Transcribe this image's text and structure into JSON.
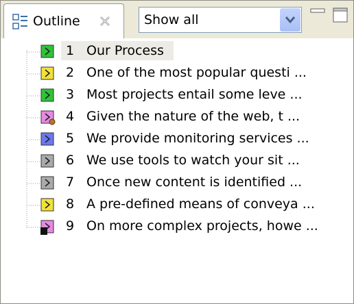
{
  "tab": {
    "label": "Outline",
    "icon": "outline-icon"
  },
  "filter": {
    "selected": "Show all"
  },
  "window_controls": {
    "minimize": "minimize-icon",
    "maximize": "maximize-icon",
    "close": "close-icon"
  },
  "colors": {
    "green": "#2fc23a",
    "yellow": "#f1e23a",
    "pink": "#e58ae0",
    "blue": "#6c78f0",
    "gray": "#aaaaaa"
  },
  "items": [
    {
      "num": "1",
      "text": "Our Process",
      "color": "green",
      "selected": true
    },
    {
      "num": "2",
      "text": "One of the most popular questi ...",
      "color": "yellow"
    },
    {
      "num": "3",
      "text": "Most projects entail some leve ...",
      "color": "green"
    },
    {
      "num": "4",
      "text": "Given the nature of the web, t ...",
      "color": "pink",
      "overlay": "gear"
    },
    {
      "num": "5",
      "text": "We provide monitoring services ...",
      "color": "blue"
    },
    {
      "num": "6",
      "text": "We use tools to watch your sit ...",
      "color": "gray"
    },
    {
      "num": "7",
      "text": "Once new content is identified ...",
      "color": "gray"
    },
    {
      "num": "8",
      "text": "A pre-defined means of conveya ...",
      "color": "yellow"
    },
    {
      "num": "9",
      "text": "On more complex projects, howe ...",
      "color": "pink",
      "overlay": "lock"
    }
  ]
}
